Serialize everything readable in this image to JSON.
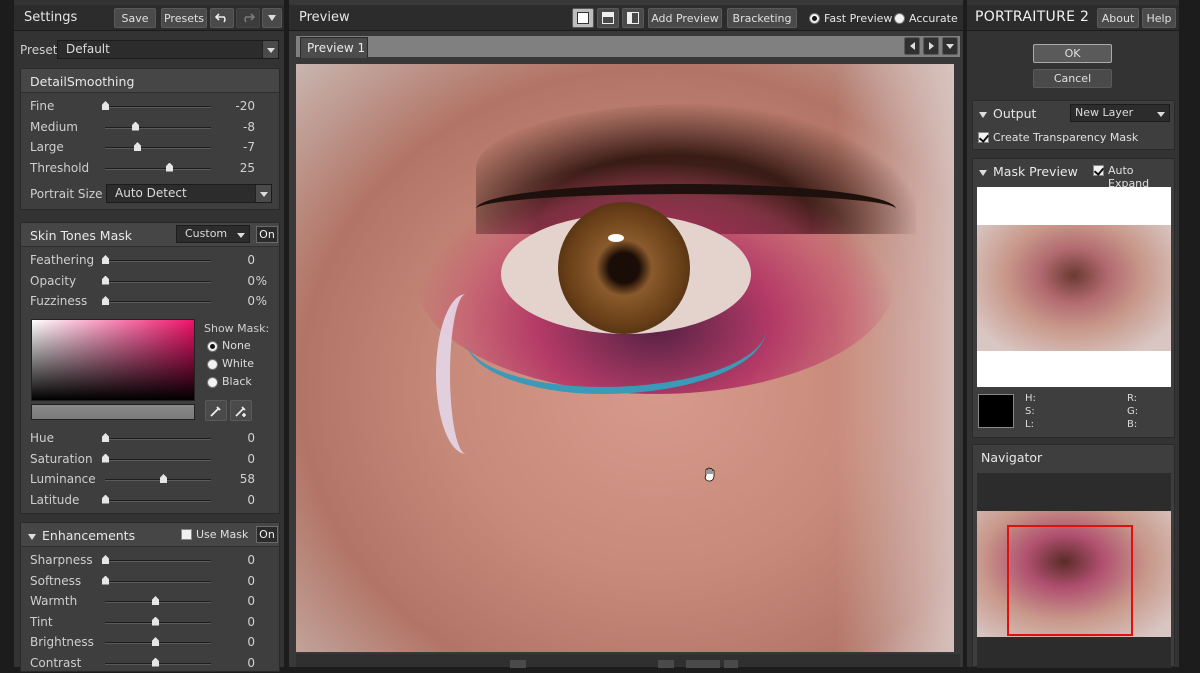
{
  "left": {
    "title": "Settings",
    "save": "Save",
    "presets": "Presets",
    "preset_label": "Preset",
    "preset_value": "Default",
    "detail": {
      "title": "DetailSmoothing",
      "sliders": [
        {
          "label": "Fine",
          "value": "-20",
          "pos": 0.0
        },
        {
          "label": "Medium",
          "value": "-8",
          "pos": 0.3
        },
        {
          "label": "Large",
          "value": "-7",
          "pos": 0.32
        },
        {
          "label": "Threshold",
          "value": "25",
          "pos": 0.64
        }
      ],
      "portrait_size_label": "Portrait Size",
      "portrait_size_value": "Auto Detect"
    },
    "skin": {
      "title": "Skin Tones Mask",
      "mode": "Custom",
      "on": "On",
      "sliders": [
        {
          "label": "Feathering",
          "value": "0",
          "unit": "",
          "pos": 0.0
        },
        {
          "label": "Opacity",
          "value": "0",
          "unit": "%",
          "pos": 0.0
        },
        {
          "label": "Fuzziness",
          "value": "0",
          "unit": "%",
          "pos": 0.0
        }
      ],
      "show_mask_label": "Show Mask:",
      "mask_options": [
        "None",
        "White",
        "Black"
      ],
      "mask_selected": 0,
      "sliders2": [
        {
          "label": "Hue",
          "value": "0",
          "pos": 0.0
        },
        {
          "label": "Saturation",
          "value": "0",
          "pos": 0.0
        },
        {
          "label": "Luminance",
          "value": "58",
          "pos": 0.58
        },
        {
          "label": "Latitude",
          "value": "0",
          "pos": 0.0
        }
      ]
    },
    "enh": {
      "title": "Enhancements",
      "use_mask": "Use Mask",
      "on": "On",
      "sliders": [
        {
          "label": "Sharpness",
          "value": "0",
          "pos": 0.0
        },
        {
          "label": "Softness",
          "value": "0",
          "pos": 0.0
        },
        {
          "label": "Warmth",
          "value": "0",
          "pos": 0.5
        },
        {
          "label": "Tint",
          "value": "0",
          "pos": 0.5
        },
        {
          "label": "Brightness",
          "value": "0",
          "pos": 0.5
        },
        {
          "label": "Contrast",
          "value": "0",
          "pos": 0.5
        }
      ]
    }
  },
  "center": {
    "title": "Preview",
    "add_preview": "Add Preview",
    "bracketing": "Bracketing",
    "fast_preview": "Fast Preview",
    "accurate": "Accurate",
    "tab": "Preview 1"
  },
  "right": {
    "brand": "PORTRAITURE",
    "brand_num": "2",
    "about": "About",
    "help": "Help",
    "ok": "OK",
    "cancel": "Cancel",
    "output_label": "Output",
    "output_value": "New Layer",
    "transparency": "Create Transparency Mask",
    "mask_preview": "Mask Preview",
    "auto_expand": "Auto Expand",
    "hsl": [
      "H:",
      "S:",
      "L:"
    ],
    "rgb": [
      "R:",
      "G:",
      "B:"
    ],
    "navigator": "Navigator"
  },
  "colors": {
    "accent_red": "#e01010",
    "panel": "#383838"
  }
}
